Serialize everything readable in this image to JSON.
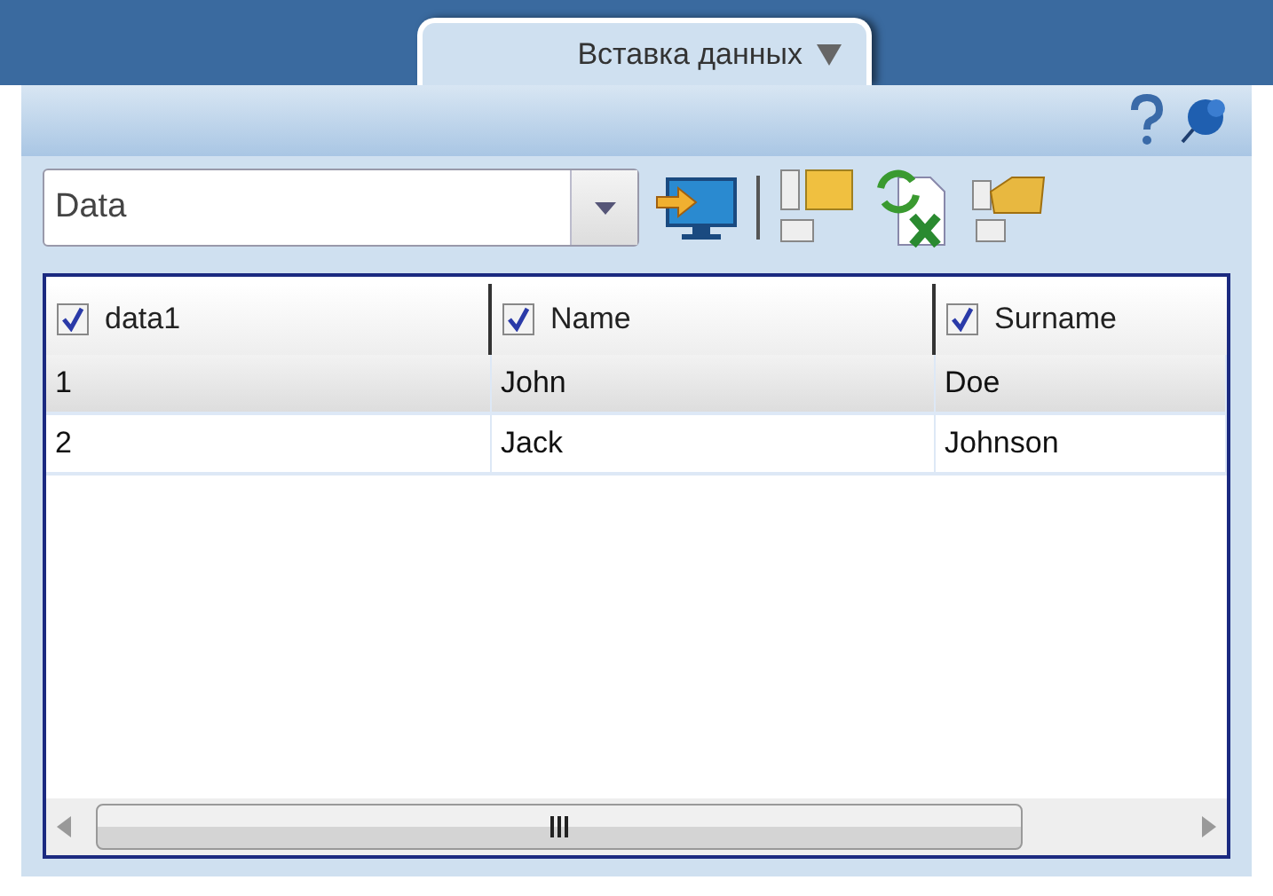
{
  "tab": {
    "label": "Вставка данных",
    "selected": true
  },
  "toolbar": {
    "source": {
      "value": "Data"
    }
  },
  "table": {
    "columns": [
      {
        "label": "data1",
        "checked": true
      },
      {
        "label": "Name",
        "checked": true
      },
      {
        "label": "Surname",
        "checked": true
      }
    ],
    "rows": [
      {
        "cells": [
          "1",
          "John",
          "Doe"
        ],
        "selected": true
      },
      {
        "cells": [
          "2",
          "Jack",
          "Johnson"
        ],
        "selected": false
      }
    ]
  }
}
